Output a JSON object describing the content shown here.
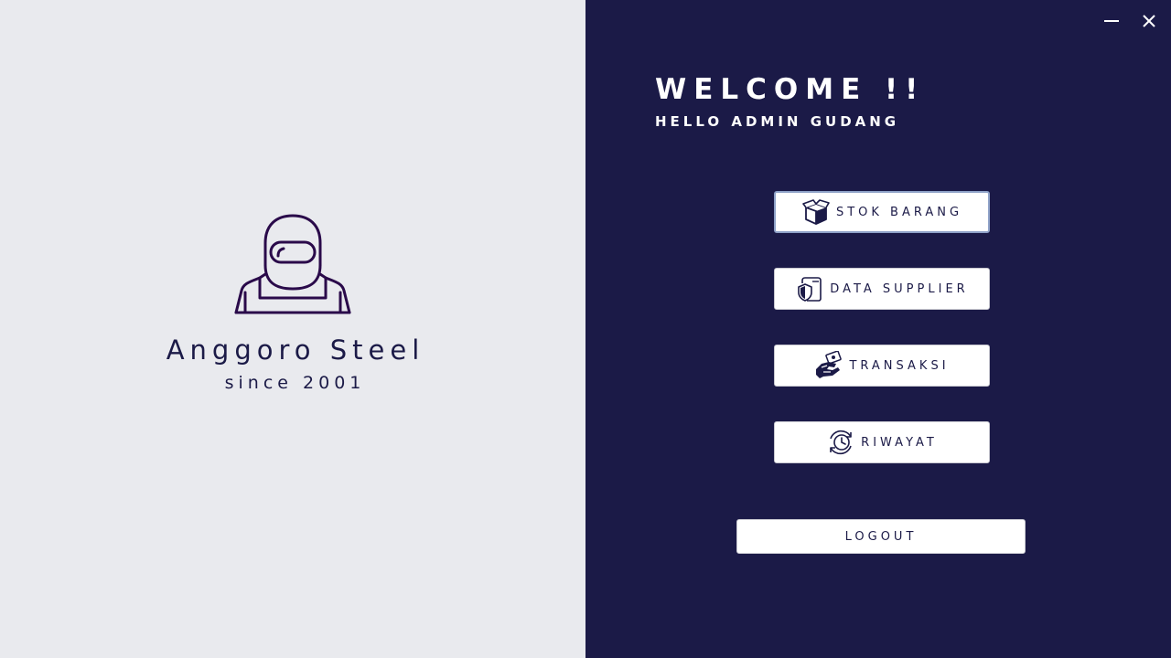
{
  "brand": {
    "name": "Anggoro Steel",
    "since": "since 2001",
    "icon": "worker-icon"
  },
  "window_controls": {
    "minimize_icon": "minimize-icon",
    "close_icon": "close-icon"
  },
  "header": {
    "welcome": "WELCOME !!",
    "greeting": "HELLO ADMIN GUDANG"
  },
  "menu": {
    "items": [
      {
        "label": "STOK BARANG",
        "icon": "box-icon"
      },
      {
        "label": "DATA SUPPLIER",
        "icon": "shield-document-icon"
      },
      {
        "label": "TRANSAKSI",
        "icon": "handshake-money-icon"
      },
      {
        "label": "RIWAYAT",
        "icon": "history-clock-icon"
      }
    ]
  },
  "logout": {
    "label": "LOGOUT"
  },
  "colors": {
    "dark_panel": "#1b1a47",
    "light_panel": "#e9eaee",
    "logo_stroke": "#2a0a4a",
    "active_border": "#8fa2c8"
  }
}
